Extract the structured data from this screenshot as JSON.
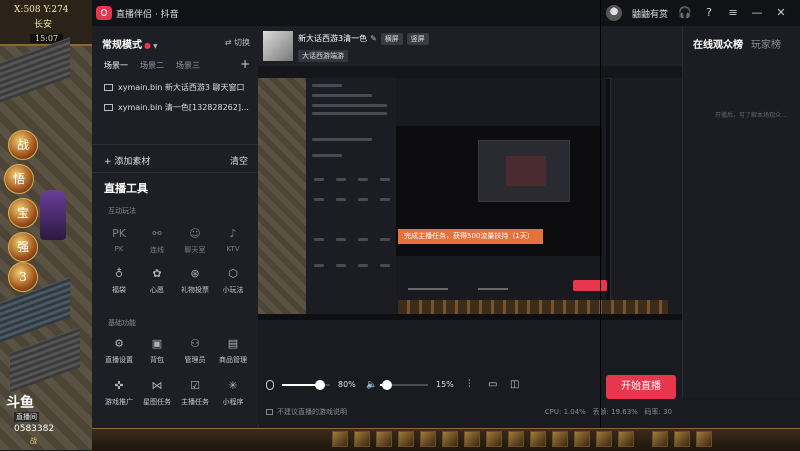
{
  "game": {
    "coords": "X:508 Y:274",
    "location": "长安",
    "time": "15:07",
    "icons": [
      "战",
      "悟",
      "宝",
      "强",
      "3"
    ],
    "douyu_logo": "斗鱼",
    "douyu_sub": "直播间",
    "douyu_id": "0583382",
    "douyu_tag": "战"
  },
  "titlebar": {
    "app_name": "直播伴侣 · 抖音",
    "username": "鼬鼬有赏"
  },
  "panel": {
    "mode_label": "常规模式",
    "switch_label": "切换",
    "scenes": [
      "场景一",
      "场景二",
      "场景三"
    ],
    "add_scene": "+",
    "sources": [
      "xymain.bin 新大话西游3 聊天窗口",
      "xymain.bin 清一色[132828262]…"
    ],
    "add_material": "+ 添加素材",
    "clear": "清空",
    "live_tools_title": "直播工具",
    "interactive_title": "互动玩法",
    "interactive_tools": [
      "PK",
      "连线",
      "聊天室",
      "KTV",
      "福袋",
      "心愿",
      "礼物投票",
      "小玩法"
    ],
    "basic_title": "基础功能",
    "basic_tools": [
      "直播设置",
      "背包",
      "管理员",
      "商品管理",
      "游戏推广",
      "星图任务",
      "主播任务",
      "小程序"
    ]
  },
  "preview": {
    "title": "新大话西游3清一色",
    "badge_landscape": "横屏",
    "badge_portrait": "竖屏",
    "category": "大话西游端游",
    "task_banner": "完成主播任务，获得500流量扶持（1天）"
  },
  "controls": {
    "mic_volume": "80%",
    "mic_level": 0.8,
    "speaker_volume": "15%",
    "speaker_level": 0.15
  },
  "status": {
    "hint": "不建议直播的游戏说明",
    "cpu": "CPU: 1.04%",
    "frame_loss": "丢帧: 19.63%",
    "bitrate": "码率: 30"
  },
  "rightpanel": {
    "tab_online": "在线观众榜",
    "tab_guests": "玩家榜",
    "hint": "开播后，可了解本场观众…"
  },
  "start_live": "开始直播"
}
